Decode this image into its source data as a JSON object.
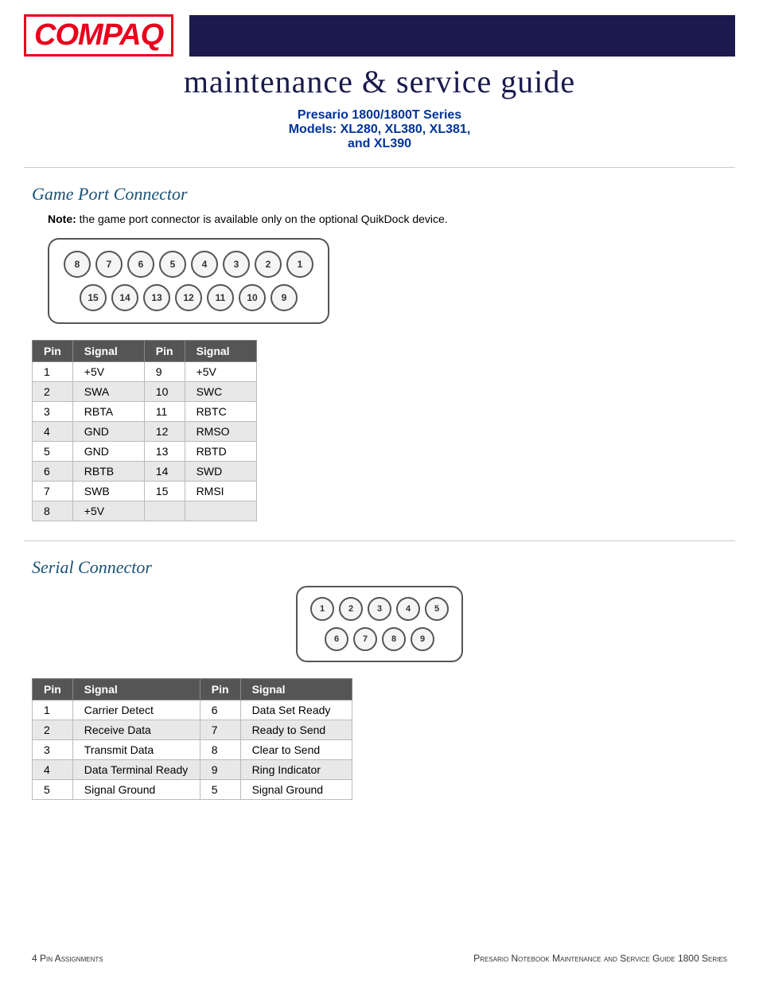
{
  "header": {
    "logo_text": "COMPAQ",
    "main_title": "maintenance & service guide",
    "subtitle1": "Presario 1800/1800T Series",
    "subtitle2": "Models: XL280, XL380, XL381,",
    "subtitle3": "and XL390"
  },
  "game_port": {
    "section_title": "Game Port Connector",
    "note_label": "Note:",
    "note_text": " the game port connector is available only on the optional QuikDock device.",
    "top_pins": [
      "8",
      "7",
      "6",
      "5",
      "4",
      "3",
      "2",
      "1"
    ],
    "bottom_pins": [
      "15",
      "14",
      "13",
      "12",
      "11",
      "10",
      "9"
    ],
    "table_headers": [
      "Pin",
      "Signal",
      "Pin",
      "Signal"
    ],
    "rows": [
      {
        "pin1": "1",
        "sig1": "+5V",
        "pin2": "9",
        "sig2": "+5V"
      },
      {
        "pin1": "2",
        "sig1": "SWA",
        "pin2": "10",
        "sig2": "SWC"
      },
      {
        "pin1": "3",
        "sig1": "RBTA",
        "pin2": "11",
        "sig2": "RBTC"
      },
      {
        "pin1": "4",
        "sig1": "GND",
        "pin2": "12",
        "sig2": "RMSO"
      },
      {
        "pin1": "5",
        "sig1": "GND",
        "pin2": "13",
        "sig2": "RBTD"
      },
      {
        "pin1": "6",
        "sig1": "RBTB",
        "pin2": "14",
        "sig2": "SWD"
      },
      {
        "pin1": "7",
        "sig1": "SWB",
        "pin2": "15",
        "sig2": "RMSI"
      },
      {
        "pin1": "8",
        "sig1": "+5V",
        "pin2": "",
        "sig2": ""
      }
    ]
  },
  "serial_connector": {
    "section_title": "Serial Connector",
    "top_pins": [
      "1",
      "2",
      "3",
      "4",
      "5"
    ],
    "bottom_pins": [
      "6",
      "7",
      "8",
      "9"
    ],
    "table_headers": [
      "Pin",
      "Signal",
      "Pin",
      "Signal"
    ],
    "rows": [
      {
        "pin1": "1",
        "sig1": "Carrier Detect",
        "pin2": "6",
        "sig2": "Data Set Ready"
      },
      {
        "pin1": "2",
        "sig1": "Receive Data",
        "pin2": "7",
        "sig2": "Ready to Send"
      },
      {
        "pin1": "3",
        "sig1": "Transmit Data",
        "pin2": "8",
        "sig2": "Clear to Send"
      },
      {
        "pin1": "4",
        "sig1": "Data Terminal Ready",
        "pin2": "9",
        "sig2": "Ring Indicator"
      },
      {
        "pin1": "5",
        "sig1": "Signal Ground",
        "pin2": "5",
        "sig2": "Signal Ground"
      }
    ]
  },
  "footer": {
    "left": "4  Pin Assignments",
    "right": "Presario Notebook Maintenance and Service Guide 1800 Series"
  }
}
